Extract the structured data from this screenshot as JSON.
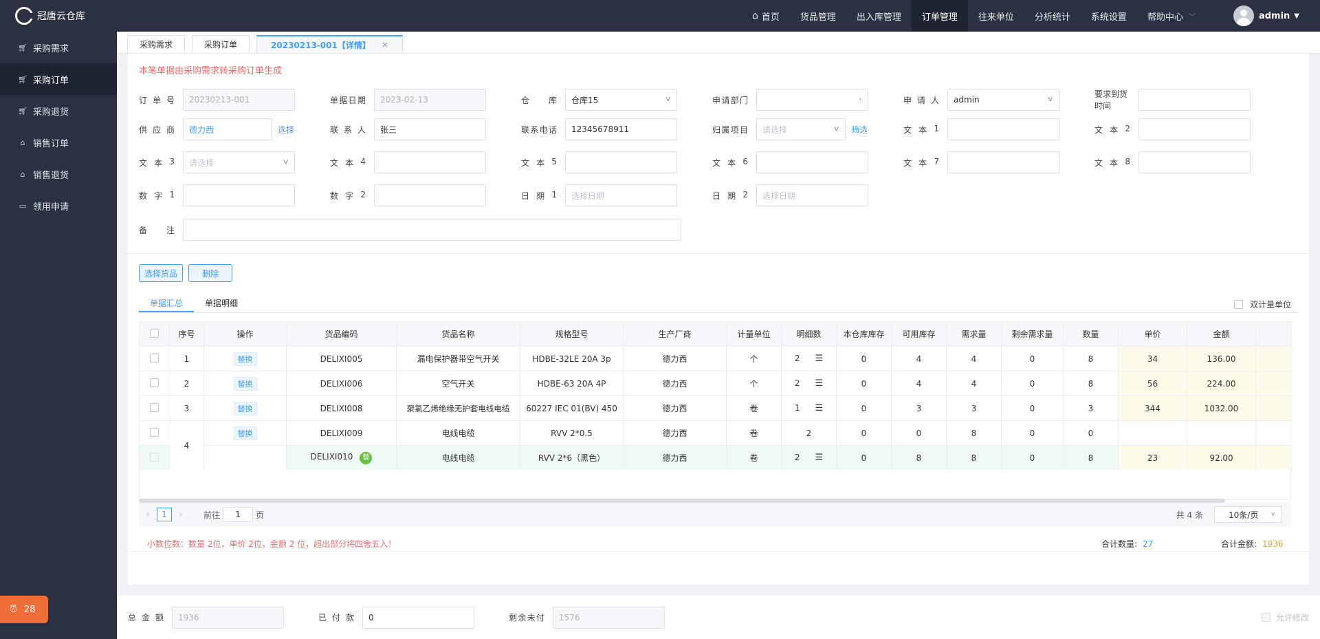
{
  "app": {
    "name": "冠唐云仓库"
  },
  "sidebar": {
    "items": [
      {
        "label": "采购需求",
        "icon": "cart-icon"
      },
      {
        "label": "采购订单",
        "icon": "cart-icon",
        "active": true
      },
      {
        "label": "采购退货",
        "icon": "cart-icon"
      },
      {
        "label": "销售订单",
        "icon": "bag-icon"
      },
      {
        "label": "销售退货",
        "icon": "bag-icon"
      },
      {
        "label": "领用申请",
        "icon": "box-icon"
      }
    ],
    "notification_count": "28"
  },
  "topnav": {
    "items": [
      "首页",
      "货品管理",
      "出入库管理",
      "订单管理",
      "往来单位",
      "分析统计",
      "系统设置",
      "帮助中心"
    ],
    "active": "订单管理",
    "user": "admin"
  },
  "tabs": [
    {
      "label": "采购需求"
    },
    {
      "label": "采购订单"
    },
    {
      "label": "20230213-001【详情】",
      "active": true
    }
  ],
  "form": {
    "notice": "本笔单据由采购需求转采购订单生成",
    "order_no": {
      "label": "订单号",
      "value": "20230213-001"
    },
    "doc_date": {
      "label": "单据日期",
      "value": "2023-02-13"
    },
    "warehouse": {
      "label": "仓库",
      "value": "仓库15"
    },
    "dept": {
      "label": "申请部门",
      "value": ""
    },
    "applicant": {
      "label": "申请人",
      "value": "admin"
    },
    "arrival": {
      "label": "要求到货时间",
      "value": ""
    },
    "supplier": {
      "label": "供应商",
      "value": "德力西",
      "action": "选择"
    },
    "contact": {
      "label": "联系人",
      "value": "张三"
    },
    "phone": {
      "label": "联系电话",
      "value": "12345678911"
    },
    "project": {
      "label": "归属项目",
      "placeholder": "请选择",
      "action": "筛选"
    },
    "text1": {
      "label": "文本1",
      "value": ""
    },
    "text2": {
      "label": "文本2",
      "value": ""
    },
    "text3": {
      "label": "文本3",
      "placeholder": "请选择"
    },
    "text4": {
      "label": "文本4",
      "value": ""
    },
    "text5": {
      "label": "文本5",
      "value": ""
    },
    "text6": {
      "label": "文本6",
      "value": ""
    },
    "text7": {
      "label": "文本7",
      "value": ""
    },
    "text8": {
      "label": "文本8",
      "value": ""
    },
    "num1": {
      "label": "数字1",
      "value": ""
    },
    "num2": {
      "label": "数字2",
      "value": ""
    },
    "date1": {
      "label": "日期1",
      "placeholder": "选择日期"
    },
    "date2": {
      "label": "日期2",
      "placeholder": "选择日期"
    },
    "remark": {
      "label": "备注",
      "value": ""
    }
  },
  "actions": {
    "select_goods": "选择货品",
    "delete": "删除"
  },
  "subtabs": [
    {
      "label": "单据汇总",
      "active": true
    },
    {
      "label": "单据明细"
    }
  ],
  "dual_unit_label": "双计量单位",
  "table": {
    "headers": [
      "",
      "序号",
      "操作",
      "货品编码",
      "货品名称",
      "规格型号",
      "生产厂商",
      "计量单位",
      "明细数",
      "本仓库库存",
      "可用库存",
      "需求量",
      "剩余需求量",
      "数量",
      "单价",
      "金额"
    ],
    "replace_label": "替换",
    "sub_badge": "替",
    "rows": [
      {
        "seq": "1",
        "code": "DELIXI005",
        "name": "漏电保护器带空气开关",
        "spec": "HDBE-32LE 20A 3p",
        "maker": "德力西",
        "unit": "个",
        "detail": "2",
        "stock": "0",
        "avail": "4",
        "demand": "4",
        "remain": "0",
        "qty": "8",
        "price": "34",
        "amount": "136.00"
      },
      {
        "seq": "2",
        "code": "DELIXI006",
        "name": "空气开关",
        "spec": "HDBE-63 20A 4P",
        "maker": "德力西",
        "unit": "个",
        "detail": "2",
        "stock": "0",
        "avail": "4",
        "demand": "4",
        "remain": "0",
        "qty": "8",
        "price": "56",
        "amount": "224.00"
      },
      {
        "seq": "3",
        "code": "DELIXI008",
        "name": "聚氯乙烯绝缘无护套电线电缆",
        "spec": "60227 IEC 01(BV) 450",
        "maker": "德力西",
        "unit": "卷",
        "detail": "1",
        "stock": "0",
        "avail": "3",
        "demand": "3",
        "remain": "0",
        "qty": "3",
        "price": "344",
        "amount": "1032.00"
      },
      {
        "seq": "4",
        "code": "DELIXI009",
        "name": "电线电缆",
        "spec": "RVV 2*0.5",
        "maker": "德力西",
        "unit": "卷",
        "detail": "2",
        "stock": "0",
        "avail": "0",
        "demand": "8",
        "remain": "0",
        "qty": "0",
        "price": "",
        "amount": ""
      },
      {
        "seq": "",
        "code": "DELIXI010",
        "name": "电线电缆",
        "spec": "RVV 2*6（黑色）",
        "maker": "德力西",
        "unit": "卷",
        "detail": "2",
        "stock": "0",
        "avail": "8",
        "demand": "8",
        "remain": "0",
        "qty": "8",
        "price": "23",
        "amount": "92.00"
      }
    ]
  },
  "pager": {
    "page": "1",
    "goto_prefix": "前往",
    "goto_value": "1",
    "goto_suffix": "页",
    "total": "共 4 条",
    "page_size": "10条/页"
  },
  "summary": {
    "decimals": "小数位数：数量 2位，单价 2位，金额 2 位，超出部分将四舍五入！",
    "qty_label": "合计数量:",
    "qty_value": "27",
    "amount_label": "合计金额:",
    "amount_value": "1936"
  },
  "footer": {
    "total": {
      "label": "总金额",
      "value": "1936"
    },
    "paid": {
      "label": "已付款",
      "value": "0"
    },
    "unpaid": {
      "label": "剩余未付",
      "value": "1576"
    },
    "allow_edit": "允许修改"
  }
}
